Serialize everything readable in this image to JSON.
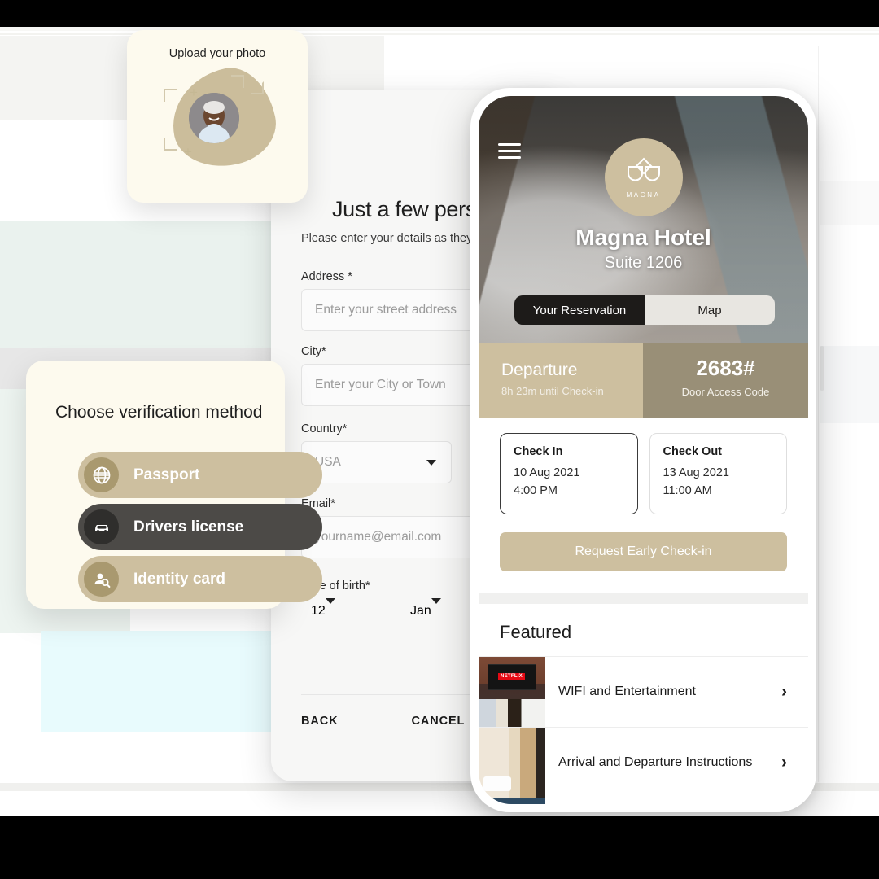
{
  "background": {
    "accent_tan": "#CDBF9F",
    "accent_dark_tan": "#998F77",
    "card_cream": "#FDFAEE",
    "dark": "#1D1B19"
  },
  "upload_card": {
    "title": "Upload your photo",
    "avatar_name": "avatar",
    "frame_icon": "crop-frame-icon",
    "plus_icon": "plus-icon"
  },
  "verification_card": {
    "title": "Choose verification method",
    "options": [
      {
        "label": "Passport",
        "icon": "globe-icon",
        "selected": false
      },
      {
        "label": "Drivers license",
        "icon": "car-icon",
        "selected": true
      },
      {
        "label": "Identity card",
        "icon": "id-person-search-icon",
        "selected": false
      }
    ]
  },
  "form": {
    "logo_text": "MAGNA",
    "title": "Just a few personal details",
    "subtitle": "Please enter your details as they appear",
    "fields": [
      {
        "label": "Address *",
        "placeholder": "Enter your street address",
        "type": "text"
      },
      {
        "label": "City*",
        "placeholder": "Enter your City or Town",
        "type": "text"
      },
      {
        "label": "Country*",
        "value": "USA",
        "type": "select"
      },
      {
        "label": "Email*",
        "placeholder": "yourname@email.com",
        "type": "text"
      }
    ],
    "dob": {
      "label": "Date of birth*",
      "day": "12",
      "month": "Jan"
    },
    "actions": {
      "back": "BACK",
      "cancel": "CANCEL"
    }
  },
  "phone": {
    "menu_icon": "hamburger-menu-icon",
    "logo_text": "MAGNA",
    "hotel_name": "Magna Hotel",
    "suite": "Suite 1206",
    "tabs": [
      {
        "label": "Your Reservation",
        "active": true
      },
      {
        "label": "Map",
        "active": false
      }
    ],
    "status_strip": {
      "departure_title": "Departure",
      "departure_sub": "8h 23m until Check-in",
      "door_code": "2683#",
      "door_code_label": "Door Access Code"
    },
    "stay": {
      "check_in": {
        "title": "Check In",
        "date": "10 Aug 2021",
        "time": "4:00 PM"
      },
      "check_out": {
        "title": "Check Out",
        "date": "13 Aug 2021",
        "time": "11:00 AM"
      }
    },
    "cta_label": "Request Early Check-in",
    "featured": {
      "heading": "Featured",
      "items": [
        {
          "label": "WIFI and Entertainment",
          "thumb": "tv-netflix-thumbnail",
          "chevron": "›"
        },
        {
          "label": "Arrival and Departure Instructions",
          "thumb": "hotel-door-thumbnail",
          "chevron": "›"
        },
        {
          "label": "",
          "thumb": "bed-thumbnail",
          "chevron": ""
        }
      ]
    }
  }
}
